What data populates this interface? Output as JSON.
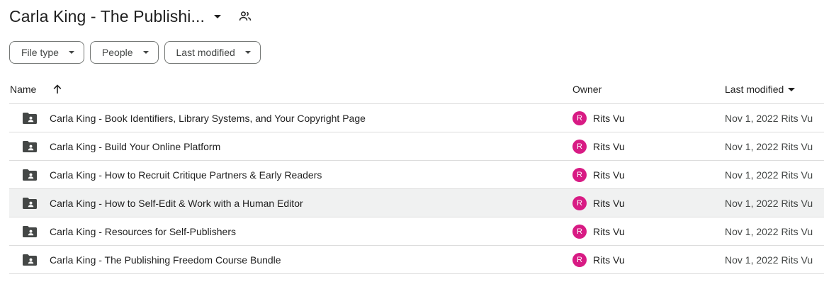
{
  "header": {
    "folder_title": "Carla King - The Publishi...",
    "title_dropdown_icon": "caret-down-icon",
    "shared_icon": "people-icon"
  },
  "filters": [
    {
      "label": "File type"
    },
    {
      "label": "People"
    },
    {
      "label": "Last modified"
    }
  ],
  "table": {
    "columns": {
      "name": "Name",
      "sort_icon": "arrow-up-icon",
      "owner": "Owner",
      "last_modified": "Last modified"
    },
    "rows": [
      {
        "icon": "shared-folder-icon",
        "name": "Carla King - Book Identifiers, Library Systems, and Your Copyright Page",
        "owner_initial": "R",
        "owner": "Rits Vu",
        "modified": "Nov 1, 2022",
        "modified_by": "Rits Vu"
      },
      {
        "icon": "shared-folder-icon",
        "name": "Carla King - Build Your Online Platform",
        "owner_initial": "R",
        "owner": "Rits Vu",
        "modified": "Nov 1, 2022",
        "modified_by": "Rits Vu"
      },
      {
        "icon": "shared-folder-icon",
        "name": "Carla King - How to Recruit Critique Partners & Early Readers",
        "owner_initial": "R",
        "owner": "Rits Vu",
        "modified": "Nov 1, 2022",
        "modified_by": "Rits Vu"
      },
      {
        "icon": "shared-folder-icon",
        "name": "Carla King - How to Self-Edit & Work with a Human Editor",
        "owner_initial": "R",
        "owner": "Rits Vu",
        "modified": "Nov 1, 2022",
        "modified_by": "Rits Vu"
      },
      {
        "icon": "shared-folder-icon",
        "name": "Carla King - Resources for Self-Publishers",
        "owner_initial": "R",
        "owner": "Rits Vu",
        "modified": "Nov 1, 2022",
        "modified_by": "Rits Vu"
      },
      {
        "icon": "shared-folder-icon",
        "name": "Carla King - The Publishing Freedom Course Bundle",
        "owner_initial": "R",
        "owner": "Rits Vu",
        "modified": "Nov 1, 2022",
        "modified_by": "Rits Vu"
      }
    ]
  },
  "colors": {
    "avatar": "#d81b84",
    "hover_row": "#f0f1f1",
    "divider": "#dcdcdc",
    "folder_icon": "#444746"
  }
}
